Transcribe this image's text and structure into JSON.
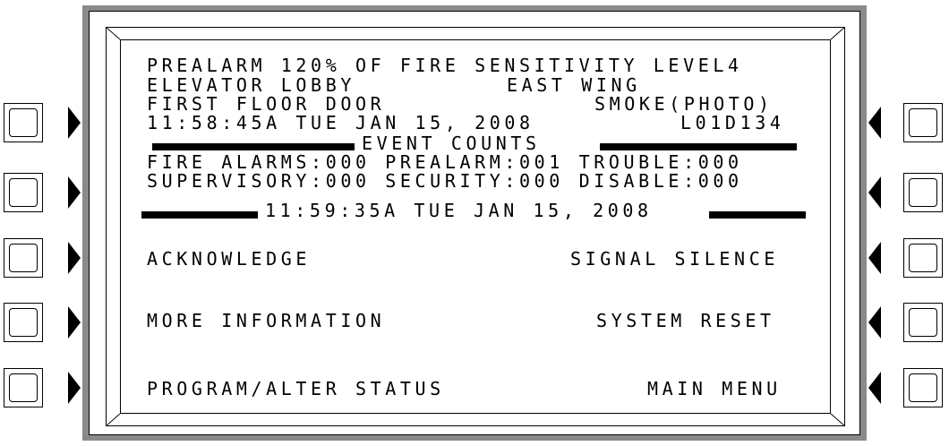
{
  "status": {
    "line1": "PREALARM 120% OF FIRE SENSITIVITY LEVEL4",
    "line2_left": "ELEVATOR LOBBY",
    "line2_right": "EAST WING",
    "line3_left": "FIRST FLOOR DOOR",
    "line3_right": "SMOKE(PHOTO)",
    "line4_left": "11:58:45A TUE JAN 15, 2008",
    "line4_right": "L01D134"
  },
  "event_counts": {
    "header": "EVENT COUNTS",
    "row1": "FIRE ALARMS:000 PREALARM:001 TROUBLE:000",
    "row2": "SUPERVISORY:000 SECURITY:000 DISABLE:000",
    "clock": "11:59:35A TUE JAN 15, 2008"
  },
  "menu": {
    "left": [
      "ACKNOWLEDGE",
      "MORE INFORMATION",
      "PROGRAM/ALTER STATUS"
    ],
    "right": [
      "SIGNAL SILENCE",
      "SYSTEM RESET",
      "MAIN MENU"
    ]
  },
  "icons": {
    "left_keys": "soft-key-with-right-arrow",
    "right_keys": "soft-key-with-left-arrow"
  }
}
